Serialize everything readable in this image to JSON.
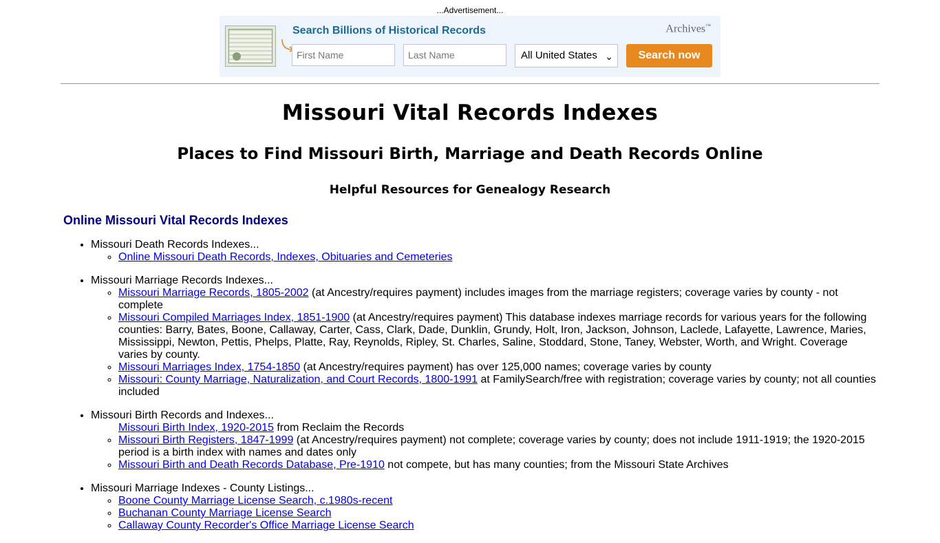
{
  "ad": {
    "label": "...Advertisement...",
    "title": "Search Billions of Historical Records",
    "brand": "Archives",
    "brand_mark": "™",
    "first_name_placeholder": "First Name",
    "last_name_placeholder": "Last Name",
    "location_selected": "All United States",
    "search_button": "Search now",
    "accent_color": "#e8891f",
    "title_color": "#1c6a94"
  },
  "page": {
    "title": "Missouri Vital Records Indexes",
    "subtitle": "Places to Find Missouri Birth, Marriage and Death Records Online",
    "tagline": "Helpful Resources for Genealogy Research",
    "section_heading": "Online Missouri Vital Records Indexes"
  },
  "sections": [
    {
      "label": "Missouri Death Records Indexes...",
      "items": [
        {
          "link": "Online Missouri Death Records, Indexes, Obituaries and Cemeteries",
          "text": ""
        }
      ]
    },
    {
      "label": "Missouri Marriage Records Indexes...",
      "items": [
        {
          "link": "Missouri Marriage Records, 1805-2002",
          "text": " (at Ancestry/requires payment) includes images from the marriage registers; coverage varies by county - not complete"
        },
        {
          "link": "Missouri Compiled Marriages Index, 1851-1900",
          "text": " (at Ancestry/requires payment) This database indexes marriage records for various years for the following counties: Barry, Bates, Boone, Callaway, Carter, Cass, Clark, Dade, Dunklin, Grundy, Holt, Iron, Jackson, Johnson, Laclede, Lafayette, Lawrence, Maries, Mississippi, Newton, Pettis, Phelps, Platte, Ray, Reynolds, Ripley, St. Charles, Saline, Stoddard, Stone, Taney, Webster, Worth, and Wright. Coverage varies by county."
        },
        {
          "link": "Missouri Marriages Index, 1754-1850",
          "text": " (at Ancestry/requires payment) has over 125,000 names; coverage varies by county"
        },
        {
          "link": "Missouri: County Marriage, Naturalization, and Court Records, 1800-1991",
          "text": " at FamilySearch/free with registration; coverage varies by county; not all counties included"
        }
      ]
    },
    {
      "label": "Missouri Birth Records and Indexes...",
      "items": [
        {
          "link": "Missouri Birth Index, 1920-2015",
          "text": " from Reclaim the Records",
          "no_bullet": true
        },
        {
          "link": "Missouri Birth Registers, 1847-1999",
          "text": " (at Ancestry/requires payment) not complete; coverage varies by county; does not include 1911-1919; the 1920-2015 period is a birth index with names and dates only"
        },
        {
          "link": "Missouri Birth and Death Records Database, Pre-1910",
          "text": " not compete, but has many counties; from the Missouri State Archives"
        }
      ]
    },
    {
      "label": "Missouri Marriage Indexes - County Listings...",
      "items": [
        {
          "link": "Boone County Marriage License Search, c.1980s-recent",
          "text": ""
        },
        {
          "link": "Buchanan County Marriage License Search",
          "text": ""
        },
        {
          "link": "Callaway County Recorder's Office Marriage License Search",
          "text": ""
        }
      ]
    }
  ]
}
